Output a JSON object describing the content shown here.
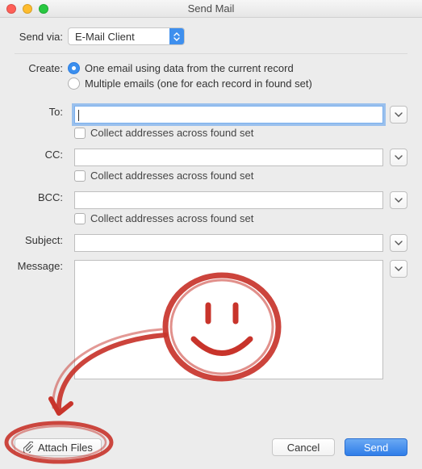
{
  "window": {
    "title": "Send Mail"
  },
  "send_via": {
    "label": "Send via:",
    "selected": "E-Mail Client"
  },
  "create": {
    "label": "Create:",
    "options": {
      "one": "One email using data from the current record",
      "multiple": "Multiple emails (one for each record in found set)"
    },
    "selected": "one"
  },
  "fields": {
    "to": {
      "label": "To:",
      "value": "",
      "collect_label": "Collect addresses across found set"
    },
    "cc": {
      "label": "CC:",
      "value": "",
      "collect_label": "Collect addresses across found set"
    },
    "bcc": {
      "label": "BCC:",
      "value": "",
      "collect_label": "Collect addresses across found set"
    },
    "subject": {
      "label": "Subject:",
      "value": ""
    },
    "message": {
      "label": "Message:",
      "value": ""
    }
  },
  "buttons": {
    "attach": "Attach Files",
    "cancel": "Cancel",
    "send": "Send"
  },
  "annotation": {
    "present": true,
    "target": "attach-files-button",
    "drawing": "smiley-arrow-circle",
    "color": "#c8342b"
  }
}
